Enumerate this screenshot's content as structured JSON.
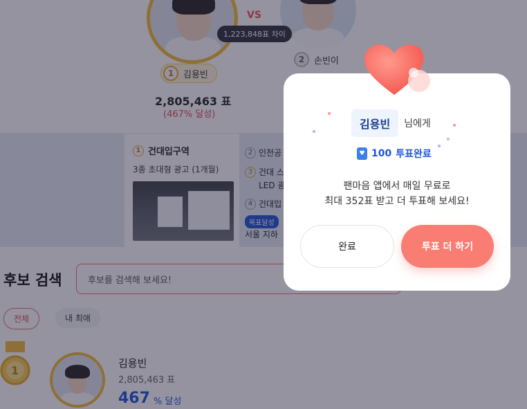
{
  "matchup": {
    "vs_label": "VS",
    "gap_badge": "1,223,848표 차이",
    "first": {
      "rank": "1",
      "name": "김용빈",
      "votes": "2,805,463 표",
      "percent": "(467% 달성)"
    },
    "second": {
      "rank": "2",
      "name": "손빈이"
    }
  },
  "ads": {
    "main": {
      "rank": "1",
      "title": "건대입구역",
      "subtitle": "3종 초대형 광고 (1개월)"
    },
    "list": [
      {
        "rank": "2",
        "text": "인천공"
      },
      {
        "rank": "3",
        "text": "건대 스"
      },
      {
        "rank": "",
        "text": "LED 광"
      },
      {
        "rank": "4",
        "text": "건대입"
      }
    ],
    "badge": "목표달성",
    "footer": "서울 지하"
  },
  "search": {
    "heading": "후보 검색",
    "placeholder": "후보를 검색해 보세요!"
  },
  "filters": {
    "all": "전체",
    "mine": "내 최애"
  },
  "result": {
    "rank": "1",
    "name": "김용빈",
    "votes": "2,805,463 표",
    "percent": "467",
    "percent_unit": "% 달성"
  },
  "modal": {
    "candidate_name": "김용빈",
    "name_suffix": "님에게",
    "vote_count": "100",
    "vote_done": "투표완료",
    "message_line1": "팬마음 앱에서 매일 무료로",
    "message_line2": "최대 352표 받고 더 투표해 보세요!",
    "done_button": "완료",
    "more_button": "투표 더 하기"
  },
  "colors": {
    "accent": "#f97d72",
    "blue": "#1e55d6",
    "gold": "#f2bb33",
    "overlay": "rgba(34,30,56,0.48)"
  }
}
